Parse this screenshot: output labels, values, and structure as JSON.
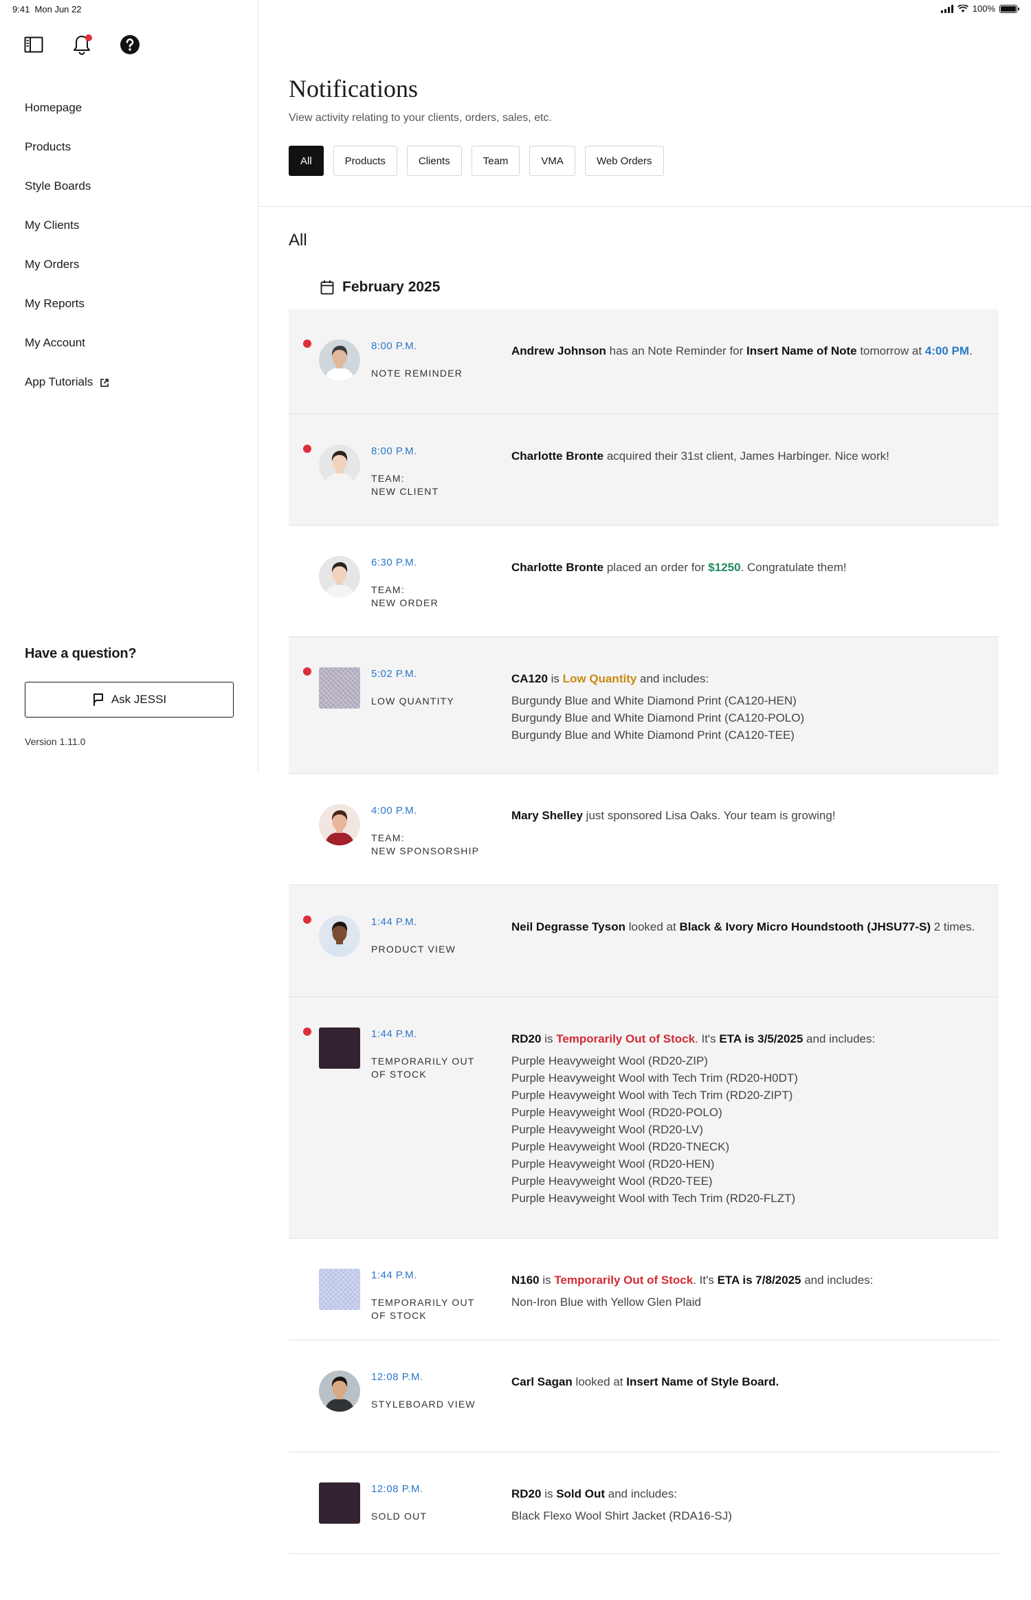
{
  "status_bar": {
    "time": "9:41",
    "date": "Mon Jun 22",
    "battery": "100%",
    "battery_level": 1.0
  },
  "sidebar": {
    "icons": [
      "sidebar-toggle-icon",
      "bell-icon",
      "help-icon"
    ],
    "nav": [
      {
        "label": "Homepage"
      },
      {
        "label": "Products"
      },
      {
        "label": "Style Boards"
      },
      {
        "label": "My Clients"
      },
      {
        "label": "My Orders"
      },
      {
        "label": "My Reports"
      },
      {
        "label": "My Account"
      },
      {
        "label": "App Tutorials",
        "icon": "external-link-icon"
      }
    ],
    "question": "Have a question?",
    "ask_label": "Ask JESSI",
    "version": "Version 1.11.0"
  },
  "header": {
    "title": "Notifications",
    "subtitle": "View activity relating to your clients, orders, sales, etc.",
    "filters": [
      "All",
      "Products",
      "Clients",
      "Team",
      "VMA",
      "Web Orders"
    ],
    "active_filter": "All"
  },
  "section": {
    "title": "All",
    "month": "February 2025"
  },
  "colors": {
    "accent_blue": "#2a78c8",
    "unread_dot": "#dc2f3c",
    "green": "#1f8a5a",
    "amber": "#c98a10",
    "red": "#d22b35"
  },
  "notifications": [
    {
      "unread": true,
      "thumb": "avatar",
      "time": "8:00 P.M.",
      "type": "NOTE REMINDER",
      "text": [
        {
          "t": "Andrew Johnson",
          "s": "b"
        },
        {
          "t": " has an Note Reminder for "
        },
        {
          "t": "Insert Name of",
          "s": "b"
        },
        {
          "t": " Note",
          "s": "b"
        },
        {
          "t": " tomorrow at "
        },
        {
          "t": "4:00 PM",
          "s": "blue"
        },
        {
          "t": "."
        }
      ]
    },
    {
      "unread": true,
      "thumb": "avatar",
      "time": "8:00 P.M.",
      "type": "TEAM:\nNEW CLIENT",
      "text": [
        {
          "t": "Charlotte Bronte",
          "s": "b"
        },
        {
          "t": " acquired their 31st client, James Harbinger. Nice work!"
        }
      ]
    },
    {
      "unread": false,
      "thumb": "avatar",
      "time": "6:30 P.M.",
      "type": "TEAM:\nNEW ORDER",
      "text": [
        {
          "t": "Charlotte Bronte",
          "s": "b"
        },
        {
          "t": " placed an order for "
        },
        {
          "t": "$1250",
          "s": "green"
        },
        {
          "t": ". Congratulate them!"
        }
      ]
    },
    {
      "unread": true,
      "thumb": "swatch",
      "swatch_color": "#b7b0c4",
      "time": "5:02 P.M.",
      "type": "LOW QUANTITY",
      "text": [
        {
          "t": "CA120",
          "s": "b"
        },
        {
          "t": " is "
        },
        {
          "t": "Low Quantity",
          "s": "amber"
        },
        {
          "t": " and includes:"
        }
      ],
      "lines": [
        "Burgundy Blue and White Diamond Print (CA120-HEN)",
        "Burgundy Blue and White Diamond Print (CA120-POLO)",
        "Burgundy Blue and White Diamond Print (CA120-TEE)"
      ]
    },
    {
      "unread": false,
      "thumb": "avatar",
      "time": "4:00 P.M.",
      "type": "TEAM:\nNEW SPONSORSHIP",
      "text": [
        {
          "t": "Mary Shelley",
          "s": "b"
        },
        {
          "t": " just sponsored Lisa Oaks. Your team is growing!"
        }
      ]
    },
    {
      "unread": true,
      "thumb": "avatar",
      "time": "1:44 P.M.",
      "type": "PRODUCT VIEW",
      "text": [
        {
          "t": "Neil Degrasse Tyson",
          "s": "b"
        },
        {
          "t": " looked at "
        },
        {
          "t": "Black & Ivory Micro Houndstooth (JHSU77-S)",
          "s": "b"
        },
        {
          "t": " 2 times."
        }
      ]
    },
    {
      "unread": true,
      "thumb": "swatch",
      "swatch_color": "#33222f",
      "time": "1:44 P.M.",
      "type": "TEMPORARILY OUT\nOF STOCK",
      "text": [
        {
          "t": "RD20",
          "s": "b"
        },
        {
          "t": " is "
        },
        {
          "t": "Temporarily Out of Stock",
          "s": "red"
        },
        {
          "t": ". It's "
        },
        {
          "t": "ETA is 3/5/2025",
          "s": "b"
        },
        {
          "t": " and includes:"
        }
      ],
      "lines": [
        "Purple Heavyweight Wool (RD20-ZIP)",
        "Purple Heavyweight Wool with Tech Trim (RD20-H0DT)",
        "Purple Heavyweight Wool with Tech Trim (RD20-ZIPT)",
        "Purple Heavyweight Wool (RD20-POLO)",
        "Purple Heavyweight Wool (RD20-LV)",
        "Purple Heavyweight Wool (RD20-TNECK)",
        "Purple Heavyweight Wool (RD20-HEN)",
        "Purple Heavyweight Wool (RD20-TEE)",
        "Purple Heavyweight Wool with Tech Trim (RD20-FLZT)"
      ]
    },
    {
      "unread": false,
      "thumb": "swatch",
      "swatch_color": "#c3ccef",
      "time": "1:44 P.M.",
      "type": "TEMPORARILY OUT\nOF STOCK",
      "text": [
        {
          "t": "N160",
          "s": "b"
        },
        {
          "t": " is "
        },
        {
          "t": "Temporarily Out of Stock",
          "s": "red"
        },
        {
          "t": ". It's "
        },
        {
          "t": "ETA is 7/8/2025",
          "s": "b"
        },
        {
          "t": " and includes:"
        }
      ],
      "lines": [
        "Non-Iron Blue with Yellow Glen Plaid"
      ]
    },
    {
      "unread": false,
      "thumb": "avatar",
      "time": "12:08 P.M.",
      "type": "STYLEBOARD VIEW",
      "text": [
        {
          "t": "Carl Sagan",
          "s": "b"
        },
        {
          "t": " looked at "
        },
        {
          "t": "Insert Name of Style Board.",
          "s": "b"
        }
      ]
    },
    {
      "unread": false,
      "thumb": "swatch",
      "swatch_color": "#33222f",
      "time": "12:08 P.M.",
      "type": "SOLD OUT",
      "text": [
        {
          "t": "RD20",
          "s": "b"
        },
        {
          "t": " is "
        },
        {
          "t": "Sold Out",
          "s": "b"
        },
        {
          "t": " and includes:"
        }
      ],
      "lines": [
        "Black Flexo Wool Shirt Jacket (RDA16-SJ)"
      ]
    }
  ]
}
